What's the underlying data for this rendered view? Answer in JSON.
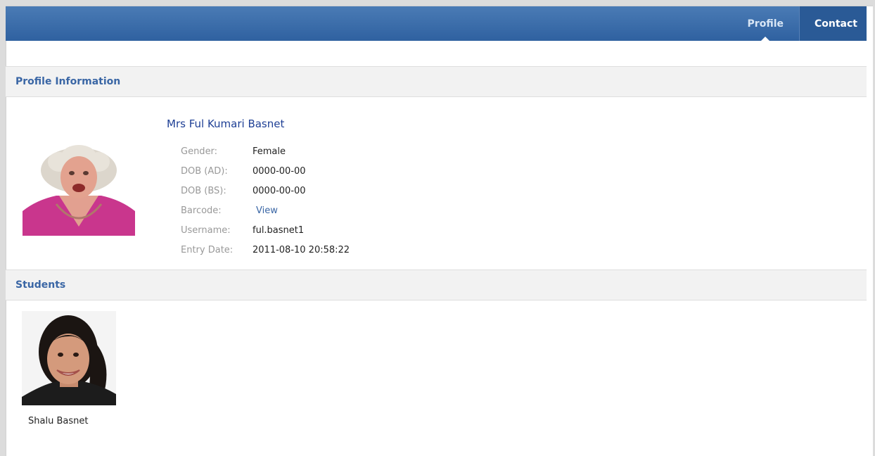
{
  "nav": {
    "tabs": [
      {
        "label": "Profile",
        "active": true
      },
      {
        "label": "Contact",
        "active": false
      }
    ]
  },
  "profile_section": {
    "title": "Profile Information",
    "name": "Mrs Ful Kumari Basnet",
    "photo_icon": "elderly-woman-photo",
    "fields": [
      {
        "label": "Gender:",
        "value": "Female"
      },
      {
        "label": "DOB (AD):",
        "value": "0000-00-00"
      },
      {
        "label": "DOB (BS):",
        "value": "0000-00-00"
      },
      {
        "label": "Barcode:",
        "value": "View"
      },
      {
        "label": "Username:",
        "value": "ful.basnet1"
      },
      {
        "label": "Entry Date:",
        "value": "2011-08-10 20:58:22"
      }
    ]
  },
  "students_section": {
    "title": "Students",
    "students": [
      {
        "name": "Shalu Basnet",
        "photo_icon": "girl-photo"
      }
    ]
  },
  "colors": {
    "header_blue": "#2f61a0",
    "section_title": "#3a66a5",
    "name_color": "#1e3f95"
  }
}
